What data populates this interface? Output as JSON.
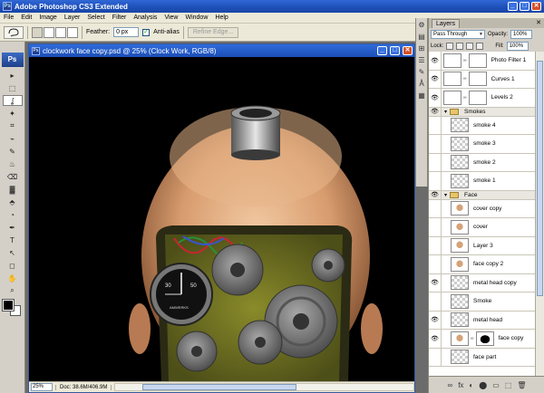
{
  "app": {
    "title": "Adobe Photoshop CS3 Extended",
    "icon": "Ps",
    "min": "_",
    "max": "□",
    "close": "✕"
  },
  "menu": [
    "File",
    "Edit",
    "Image",
    "Layer",
    "Select",
    "Filter",
    "Analysis",
    "View",
    "Window",
    "Help"
  ],
  "options": {
    "feather_label": "Feather:",
    "feather_value": "0 px",
    "antialias_label": "Anti-alias",
    "antialias_checked": "✓",
    "refine_label": "Refine Edge..."
  },
  "tools": {
    "logo": "Ps",
    "items": [
      "▸",
      "⬚",
      "ʆ",
      "✦",
      "⌗",
      "⌁",
      "✎",
      "♨",
      "⌫",
      "▓",
      "⬘",
      "◔",
      "✒",
      "T",
      "↖",
      "◻",
      "✋",
      "⌕"
    ]
  },
  "document": {
    "title": "clockwork face copy.psd @ 25% (Clock Work, RGB/8)",
    "icon": "Ps",
    "zoom": "25%",
    "info": "Doc: 38.6M/406.9M",
    "gauge_text": "AMWERKS",
    "gauge_ticks": [
      "30",
      "50"
    ]
  },
  "dock": [
    "⚙",
    "▤",
    "⊞",
    "☰",
    "✎",
    "Å",
    "▦"
  ],
  "layers": {
    "tab": "Layers",
    "close": "✕",
    "blend_mode": "Pass Through",
    "opacity_label": "Opacity:",
    "opacity_value": "100%",
    "lock_label": "Lock:",
    "fill_label": "Fill:",
    "fill_value": "100%",
    "items": [
      {
        "name": "Photo Filter 1"
      },
      {
        "name": "Curves 1"
      },
      {
        "name": "Levels 2"
      },
      {
        "name": "Smokes"
      },
      {
        "name": "smoke 4"
      },
      {
        "name": "smoke 3"
      },
      {
        "name": "smoke 2"
      },
      {
        "name": "smoke 1"
      },
      {
        "name": "Face"
      },
      {
        "name": "cover copy"
      },
      {
        "name": "cover"
      },
      {
        "name": "Layer 3"
      },
      {
        "name": "face copy 2"
      },
      {
        "name": "metal head copy"
      },
      {
        "name": "Smoke"
      },
      {
        "name": "metal head"
      },
      {
        "name": "face copy"
      },
      {
        "name": "face part"
      }
    ],
    "eye": "👁",
    "footer": [
      "∞",
      "fx",
      "◐",
      "⬤",
      "▭",
      "⬚",
      "🗑"
    ]
  }
}
